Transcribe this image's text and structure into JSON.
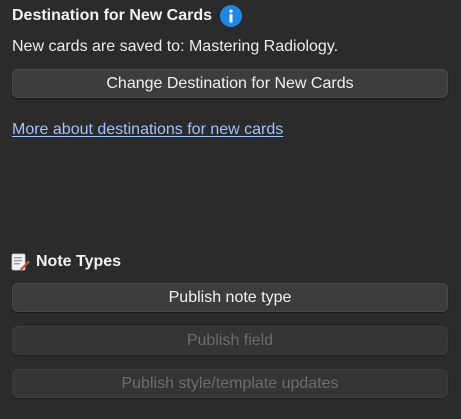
{
  "destination": {
    "title": "Destination for New Cards",
    "info_icon": "info-icon",
    "description": "New cards are saved to: Mastering Radiology.",
    "change_button_label": "Change Destination for New Cards",
    "more_link_text": "More about destinations for new cards "
  },
  "note_types": {
    "title": "Note Types",
    "icon": "note-edit-icon",
    "publish_note_type_label": "Publish note type",
    "publish_field_label": "Publish field",
    "publish_style_label": "Publish style/template updates"
  },
  "colors": {
    "background": "#2b2b2b",
    "button": "#3d3d3d",
    "link": "#9ec2ff",
    "info_blue": "#1e88e5",
    "disabled_text": "#6c6c6c"
  }
}
